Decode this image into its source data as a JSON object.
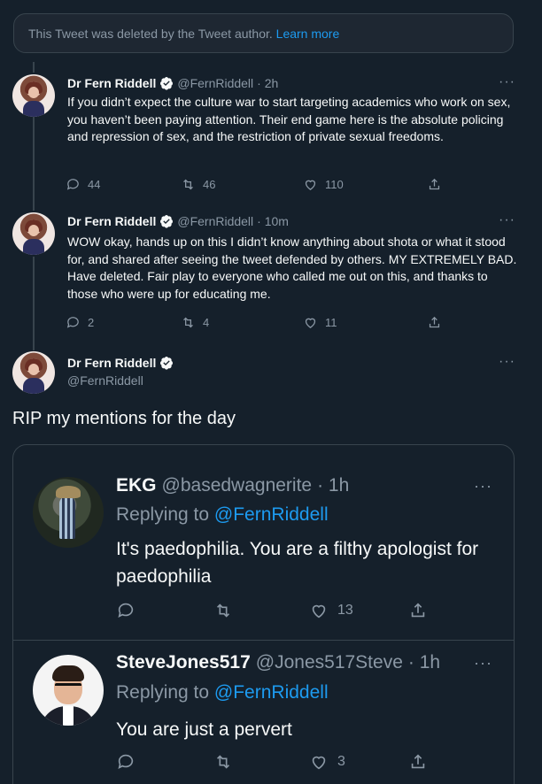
{
  "deleted_notice": {
    "text": "This Tweet was deleted by the Tweet author.",
    "link": "Learn more"
  },
  "tweets": [
    {
      "name": "Dr Fern Riddell",
      "handle": "@FernRiddell",
      "time": "· 2h",
      "text": "If you didn’t expect the culture war to start targeting academics who work on sex, you haven’t been paying attention. Their end game here is the absolute policing and repression of sex, and the restriction of private sexual freedoms.",
      "replies": "44",
      "retweets": "46",
      "likes": "110"
    },
    {
      "name": "Dr Fern Riddell",
      "handle": "@FernRiddell",
      "time": "· 10m",
      "text": "WOW okay, hands up on this I didn’t know anything about shota or what it stood for, and shared after seeing the tweet defended by others. MY EXTREMELY BAD. Have deleted. Fair play to everyone who called me out on this, and thanks to those who were up for educating me.",
      "replies": "2",
      "retweets": "4",
      "likes": "11"
    }
  ],
  "main_tweet": {
    "name": "Dr Fern Riddell",
    "handle": "@FernRiddell",
    "text": "RIP my mentions for the day"
  },
  "quoted_replies": [
    {
      "name": "EKG",
      "handle": "@basedwagnerite",
      "time": "· 1h",
      "replying_prefix": "Replying to",
      "replying_to": "@FernRiddell",
      "text": "It's paedophilia. You are a filthy apologist for paedophilia",
      "likes": "13"
    },
    {
      "name": "SteveJones517",
      "handle": "@Jones517Steve",
      "time": "· 1h",
      "replying_prefix": "Replying to",
      "replying_to": "@FernRiddell",
      "text": "You are just a pervert",
      "likes": "3"
    }
  ],
  "more_glyph": "···",
  "colors": {
    "background": "#15202b",
    "accent": "#1d9bf0",
    "muted": "#8b98a5",
    "border": "#38444d"
  }
}
